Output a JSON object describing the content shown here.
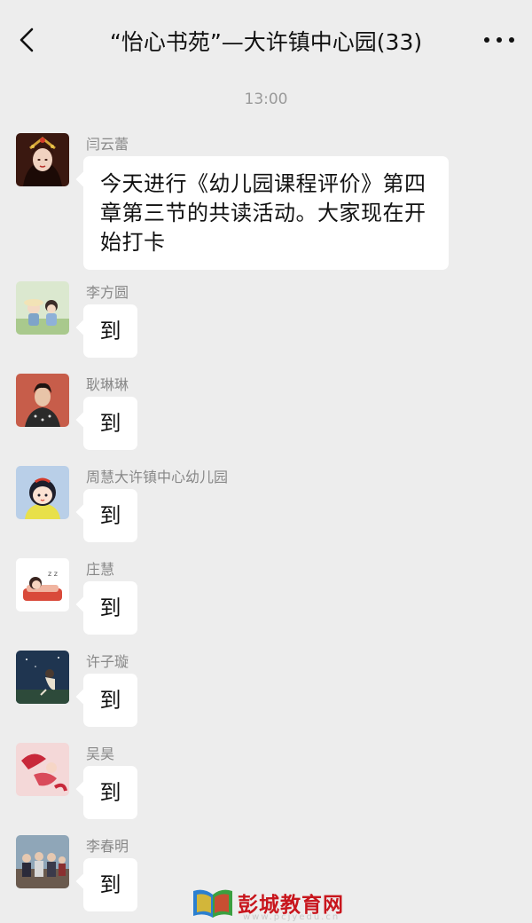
{
  "header": {
    "title": "“怡心书苑”—大许镇中心园(33)",
    "back_icon": "chevron-left-icon",
    "more_icon": "more-dots-icon"
  },
  "timestamp": "13:00",
  "messages": [
    {
      "sender": "闫云蕾",
      "text": "今天进行《幼儿园课程评价》第四章第三节的共读活动。大家现在开始打卡"
    },
    {
      "sender": "李方圆",
      "text": "到"
    },
    {
      "sender": "耿琳琳",
      "text": "到"
    },
    {
      "sender": "周慧大许镇中心幼儿园",
      "text": "到"
    },
    {
      "sender": "庄慧",
      "text": "到"
    },
    {
      "sender": "许子璇",
      "text": "到"
    },
    {
      "sender": "吴昊",
      "text": "到"
    },
    {
      "sender": "李春明",
      "text": "到"
    }
  ],
  "watermark": {
    "text": "彭城教育网",
    "url": "www.pcjyedu.cn",
    "icon": "open-book-logo-icon"
  },
  "colors": {
    "background": "#ededed",
    "bubble": "#ffffff",
    "watermark": "#c8161d"
  }
}
